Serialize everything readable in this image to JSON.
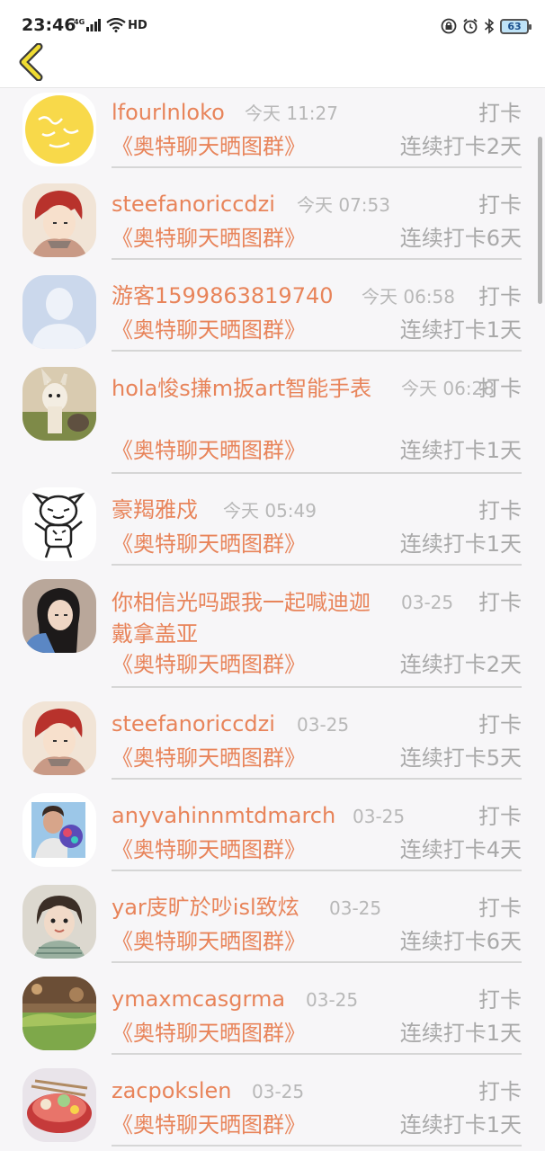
{
  "status": {
    "time": "23:46",
    "network": "4G",
    "hd": "HD",
    "battery": "63"
  },
  "rows": [
    {
      "name": "lfourlnloko",
      "time": "今天 11:27",
      "action": "打卡",
      "group": "《奥特聊天晒图群》",
      "streak": "连续打卡2天"
    },
    {
      "name": "steefanoriccdzi",
      "time": "今天 07:53",
      "action": "打卡",
      "group": "《奥特聊天晒图群》",
      "streak": "连续打卡6天"
    },
    {
      "name": "游客1599863819740",
      "time": "今天 06:58",
      "action": "打卡",
      "group": "《奥特聊天晒图群》",
      "streak": "连续打卡1天"
    },
    {
      "name": "hola悛s搛m扳art智能手表",
      "time": "今天 06:28",
      "action": "打卡",
      "group": "《奥特聊天晒图群》",
      "streak": "连续打卡1天"
    },
    {
      "name": "豪羯雅戍",
      "time": "今天 05:49",
      "action": "打卡",
      "group": "《奥特聊天晒图群》",
      "streak": "连续打卡1天"
    },
    {
      "name": "你相信光吗跟我一起喊迪迦戴拿盖亚",
      "time": "03-25",
      "action": "打卡",
      "group": "《奥特聊天晒图群》",
      "streak": "连续打卡2天"
    },
    {
      "name": "steefanoriccdzi",
      "time": "03-25",
      "action": "打卡",
      "group": "《奥特聊天晒图群》",
      "streak": "连续打卡5天"
    },
    {
      "name": "anyvahinnmtdmarch",
      "time": "03-25",
      "action": "打卡",
      "group": "《奥特聊天晒图群》",
      "streak": "连续打卡4天"
    },
    {
      "name": "yar庋旷於吵isl致炫",
      "time": "03-25",
      "action": "打卡",
      "group": "《奥特聊天晒图群》",
      "streak": "连续打卡6天"
    },
    {
      "name": "ymaxmcasgrma",
      "time": "03-25",
      "action": "打卡",
      "group": "《奥特聊天晒图群》",
      "streak": "连续打卡1天"
    },
    {
      "name": "zacpokslen",
      "time": "03-25",
      "action": "打卡",
      "group": "《奥特聊天晒图群》",
      "streak": "连续打卡1天"
    }
  ],
  "colors": {
    "accent": "#e8845a",
    "muted": "#a9a9a9",
    "background": "#f7f6f8",
    "back_icon": "#f0dc32"
  },
  "icons": {
    "back": "chevron-left-icon"
  }
}
